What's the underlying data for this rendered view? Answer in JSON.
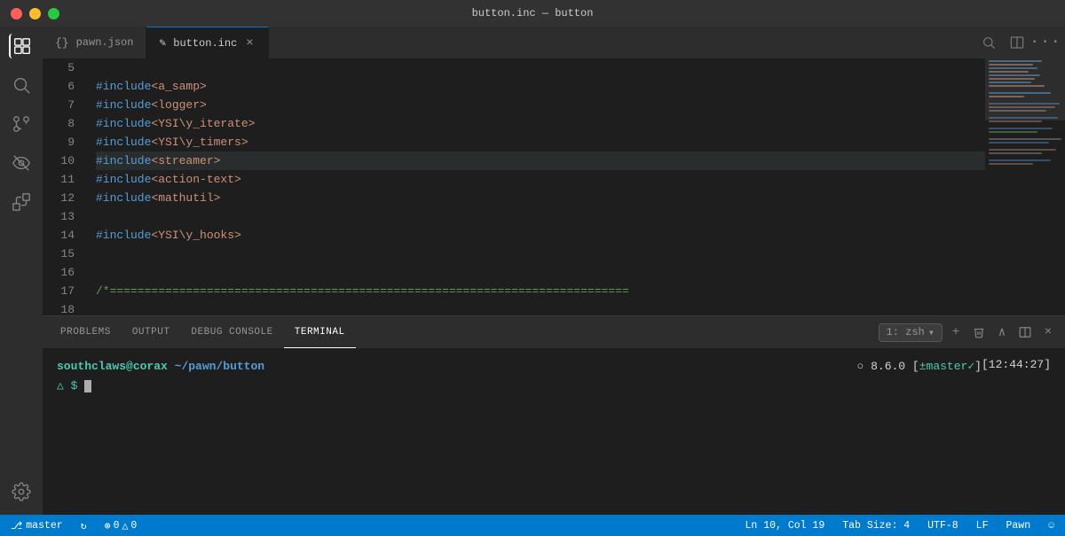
{
  "titlebar": {
    "title": "button.inc — button"
  },
  "tabs": [
    {
      "id": "pawn-json",
      "label": "pawn.json",
      "icon": "{}",
      "active": false,
      "modified": false
    },
    {
      "id": "button-inc",
      "label": "button.inc",
      "icon": "✎",
      "active": true,
      "modified": false
    }
  ],
  "code": {
    "lines": [
      {
        "num": 5,
        "content": "",
        "highlighted": false
      },
      {
        "num": 6,
        "content": "#include <a_samp>",
        "highlighted": false
      },
      {
        "num": 7,
        "content": "#include <logger>",
        "highlighted": false
      },
      {
        "num": 8,
        "content": "#include <YSI\\y_iterate>",
        "highlighted": false
      },
      {
        "num": 9,
        "content": "#include <YSI\\y_timers>",
        "highlighted": false
      },
      {
        "num": 10,
        "content": "#include <streamer>",
        "highlighted": true
      },
      {
        "num": 11,
        "content": "#include <action-text>",
        "highlighted": false
      },
      {
        "num": 12,
        "content": "#include <mathutil>",
        "highlighted": false
      },
      {
        "num": 13,
        "content": "",
        "highlighted": false
      },
      {
        "num": 14,
        "content": "#include <YSI\\y_hooks>",
        "highlighted": false
      },
      {
        "num": 15,
        "content": "",
        "highlighted": false
      },
      {
        "num": 16,
        "content": "",
        "highlighted": false
      },
      {
        "num": 17,
        "content": "/*===========================================================================",
        "highlighted": false
      },
      {
        "num": 18,
        "content": "",
        "highlighted": false
      }
    ]
  },
  "panel_tabs": [
    {
      "id": "problems",
      "label": "PROBLEMS",
      "active": false
    },
    {
      "id": "output",
      "label": "OUTPUT",
      "active": false
    },
    {
      "id": "debug-console",
      "label": "DEBUG CONSOLE",
      "active": false
    },
    {
      "id": "terminal",
      "label": "TERMINAL",
      "active": true
    }
  ],
  "terminal": {
    "terminal_selector": "1: zsh",
    "time": "[12:44:27]",
    "user": "southclaws",
    "host": "corax",
    "path": "~/pawn/button",
    "prompt": "△ $",
    "node_version": "8.6.0",
    "branch": "master",
    "check": "✓"
  },
  "statusbar": {
    "branch": "master",
    "sync_icon": "↻",
    "error_icon": "⊗",
    "errors": "0",
    "warning_icon": "△",
    "warnings": "0",
    "position": "Ln 10, Col 19",
    "tab_size": "Tab Size: 4",
    "encoding": "UTF-8",
    "line_ending": "LF",
    "language": "Pawn",
    "smiley": "☺"
  },
  "activity_icons": [
    {
      "id": "explorer",
      "symbol": "⬜",
      "active": true
    },
    {
      "id": "search",
      "symbol": "🔍",
      "active": false
    },
    {
      "id": "source-control",
      "symbol": "⑂",
      "active": false
    },
    {
      "id": "extensions",
      "symbol": "⊞",
      "active": false
    },
    {
      "id": "copy-paste",
      "symbol": "❐",
      "active": false
    }
  ]
}
